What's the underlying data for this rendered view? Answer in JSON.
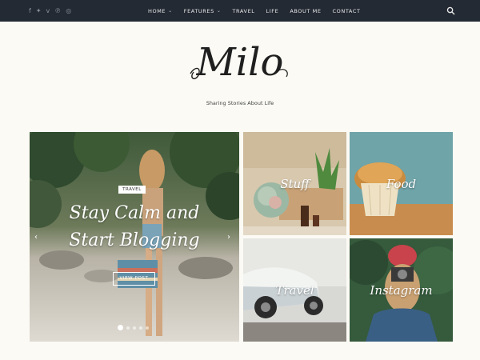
{
  "topbar": {
    "social_icons": [
      {
        "name": "facebook-icon",
        "glyph": "f"
      },
      {
        "name": "twitter-icon",
        "glyph": "✦"
      },
      {
        "name": "vimeo-icon",
        "glyph": "v"
      },
      {
        "name": "pinterest-icon",
        "glyph": "℗"
      },
      {
        "name": "instagram-icon",
        "glyph": "◎"
      }
    ],
    "nav": [
      {
        "label": "HOME",
        "has_dropdown": true
      },
      {
        "label": "FEATURES",
        "has_dropdown": true
      },
      {
        "label": "TRAVEL",
        "has_dropdown": false
      },
      {
        "label": "LIFE",
        "has_dropdown": false
      },
      {
        "label": "ABOUT ME",
        "has_dropdown": false
      },
      {
        "label": "CONTACT",
        "has_dropdown": false
      }
    ],
    "search_icon": "search-icon"
  },
  "header": {
    "logo_text": "Milo",
    "tagline": "Sharing Stories About Life"
  },
  "slider": {
    "category": "TRAVEL",
    "title_line1": "Stay Calm and",
    "title_line2": "Start Blogging",
    "button_label": "VIEW POST",
    "prev_icon": "chevron-left-icon",
    "next_icon": "chevron-right-icon",
    "slide_count": 5,
    "active_slide": 1
  },
  "categories": [
    {
      "label": "Stuff"
    },
    {
      "label": "Food"
    },
    {
      "label": "Travel"
    },
    {
      "label": "Instagram"
    }
  ],
  "colors": {
    "topbar_bg": "#232a34",
    "page_bg": "#fbfaf4"
  }
}
